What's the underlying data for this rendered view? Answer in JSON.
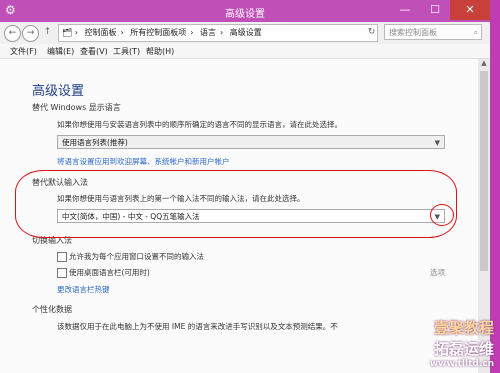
{
  "window": {
    "title": "高级设置",
    "controls": {
      "minimize": "—",
      "maximize": "☐",
      "close": "✕"
    }
  },
  "address": {
    "back": "←",
    "forward": "→",
    "up": "↑",
    "crumbs": [
      "控制面板",
      "所有控制面板项",
      "语言",
      "高级设置"
    ],
    "refresh": "↻",
    "search_placeholder": "搜索控制面板"
  },
  "menu": [
    "文件(F)",
    "编辑(E)",
    "查看(V)",
    "工具(T)",
    "帮助(H)"
  ],
  "content": {
    "heading": "高级设置",
    "display_language": {
      "title": "替代 Windows 显示语言",
      "desc": "如果你想使用与安装语言列表中的顺序所确定的语言不同的显示语言，请在此处选择。",
      "dropdown_value": "使用语言列表(推荐)",
      "link": "将语言设置应用到欢迎屏幕、系统帐户和新用户帐户"
    },
    "default_input": {
      "title": "替代默认输入法",
      "desc": "如果你想使用与语言列表上的第一个输入法不同的输入法，请在此处选择。",
      "dropdown_value": "中文(简体，中国) - 中文 - QQ五笔输入法"
    },
    "switch_input": {
      "title": "切换输入法",
      "option1": "允许我为每个应用窗口设置不同的输入法",
      "option2": "使用桌面语言栏(可用时)",
      "option2_side": "选项",
      "link": "更改语言栏热键"
    },
    "personal": {
      "title": "个性化数据",
      "desc": "该数据仅用于在此电脑上为不使用 IME 的语言来改进手写识别以及文本预测结果。不"
    }
  },
  "watermark": {
    "line1": "壹聚教程",
    "line2": "拓磊运维",
    "line3": "www.tlltd.cn"
  }
}
